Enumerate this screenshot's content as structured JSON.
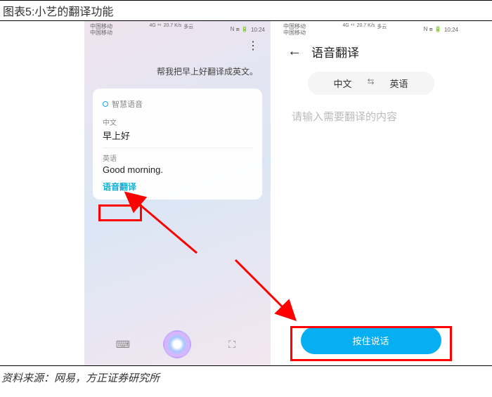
{
  "figure": {
    "title": "图表5:小艺的翻译功能"
  },
  "status": {
    "carrier": "中国移动",
    "signal": "4G ⁴⁶",
    "speed": "20.7 K/s",
    "weather": "多云",
    "icons": "N ⧈ 🔋",
    "time": "10:24"
  },
  "left": {
    "prompt": "帮我把早上好翻译成英文。",
    "cardHeader": "智慧语音",
    "srcLabel": "中文",
    "srcText": "早上好",
    "dstLabel": "英语",
    "dstText": "Good morning.",
    "voiceLink": "语音翻译"
  },
  "right": {
    "title": "语音翻译",
    "langFrom": "中文",
    "langSwap": "⇆",
    "langTo": "英语",
    "placeholder": "请输入需要翻译的内容",
    "holdTalk": "按住说话"
  },
  "source": "资料来源：网易，方正证券研究所"
}
